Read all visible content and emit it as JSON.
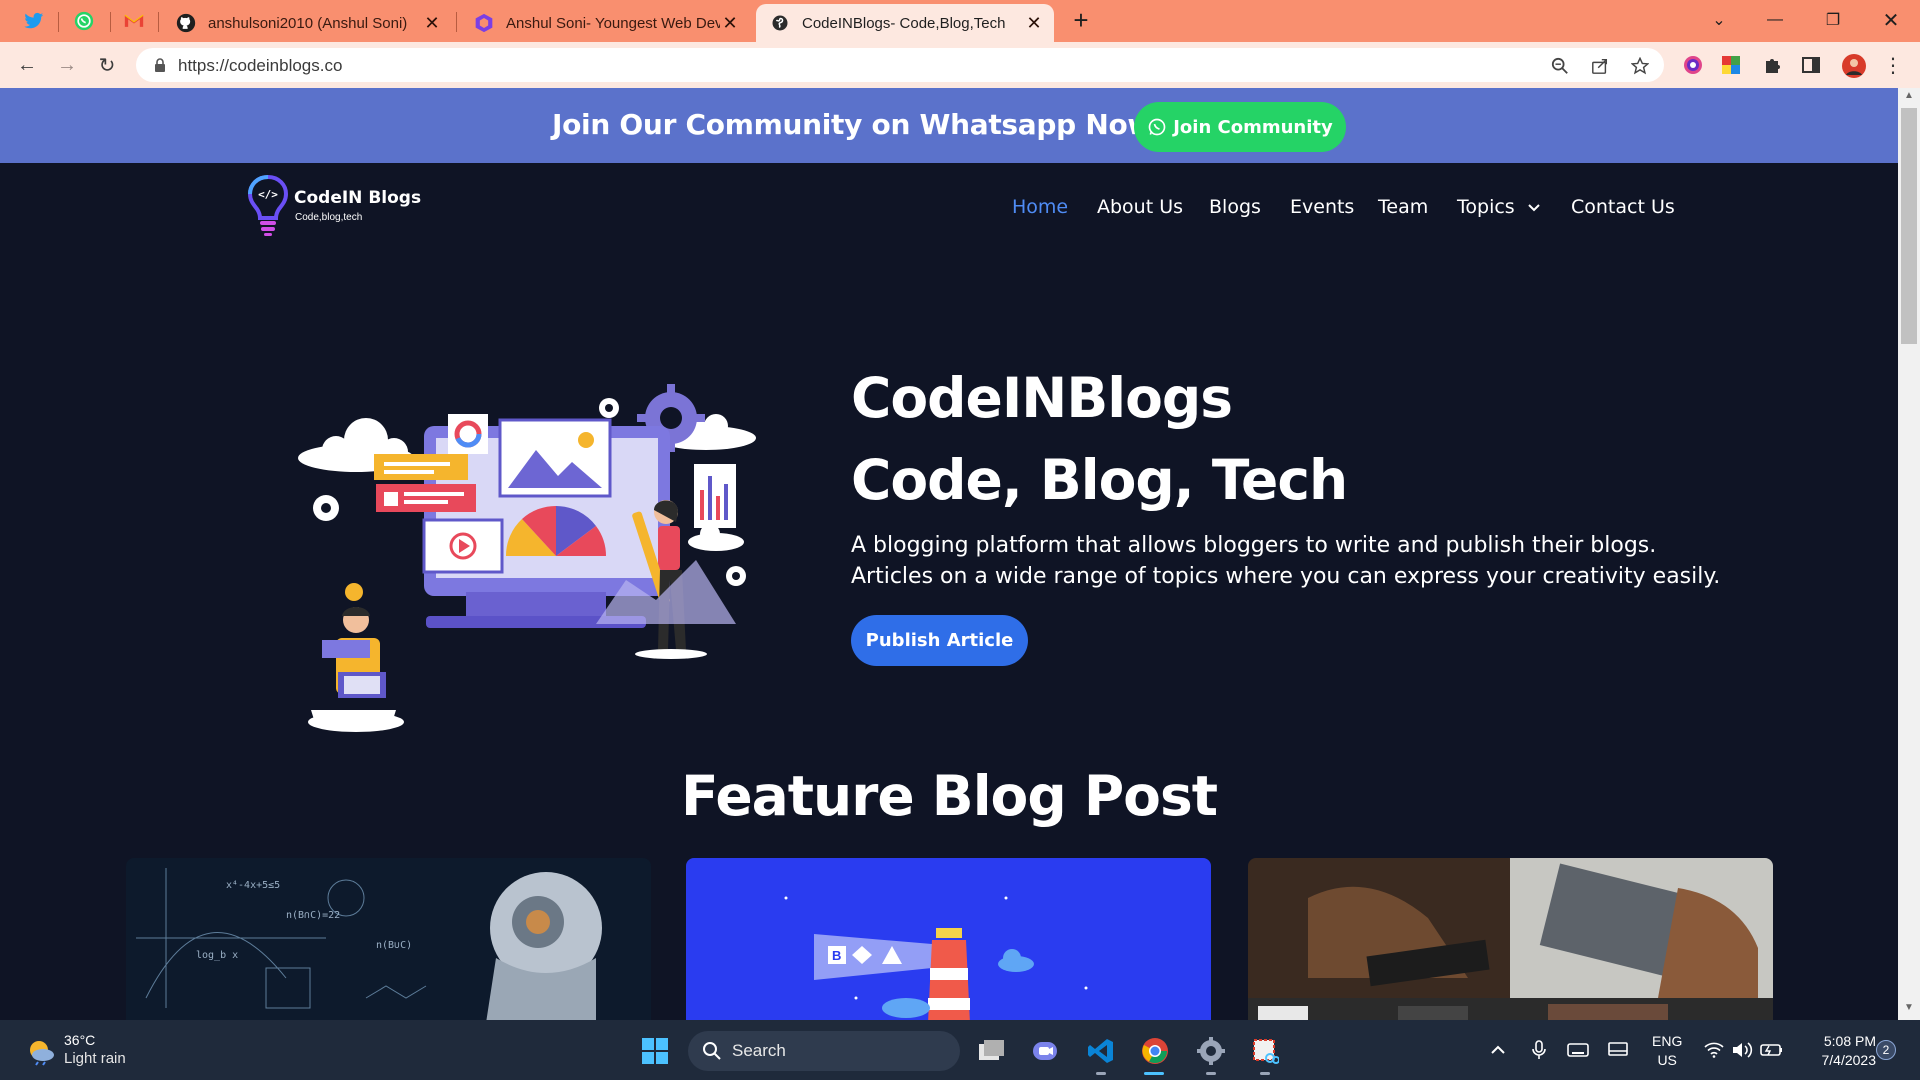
{
  "browser": {
    "tabs": [
      {
        "title": "anshulsoni2010 (Anshul Soni)",
        "favicon": "github-icon"
      },
      {
        "title": "Anshul Soni- Youngest Web Deve",
        "favicon": "portfolio-icon"
      },
      {
        "title": "CodeINBlogs- Code,Blog,Tech",
        "favicon": "globe-icon",
        "active": true
      }
    ],
    "pinned_tabs": [
      "twitter-icon",
      "whatsapp-icon",
      "gmail-icon"
    ],
    "url": "https://codeinblogs.co"
  },
  "site": {
    "banner": {
      "text": "Join Our Community on Whatsapp Now!",
      "button": "Join Community",
      "bg_color": "#5b72cb",
      "button_color": "#25d366"
    },
    "logo": {
      "name": "CodeIN Blogs",
      "tagline": "Code,blog,tech"
    },
    "nav": [
      "Home",
      "About Us",
      "Blogs",
      "Events",
      "Team",
      "Topics",
      "Contact Us"
    ],
    "active_nav": "Home",
    "hero": {
      "title": "CodeINBlogs",
      "subtitle": "Code, Blog, Tech",
      "line1": "A blogging platform that allows bloggers to write and publish their blogs.",
      "line2": "Articles on a wide range of topics where you can express your creativity easily.",
      "cta": "Publish Article"
    },
    "featured": {
      "heading": "Feature Blog Post",
      "card_count": 3
    },
    "colors": {
      "bg": "#0f1425",
      "accent": "#4f8cf5",
      "cta": "#2f6ee8"
    }
  },
  "taskbar": {
    "weather": {
      "temp": "36°C",
      "condition": "Light rain"
    },
    "search": "Search",
    "lang": "ENG",
    "region": "US",
    "time": "5:08 PM",
    "date": "7/4/2023",
    "notifications": "2"
  }
}
